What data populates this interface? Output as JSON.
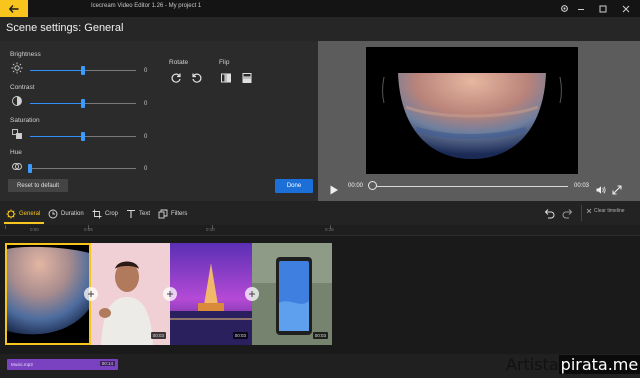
{
  "window": {
    "title": "Icecream Video Editor 1.26 - My project 1",
    "accent": "#f7c51e"
  },
  "header": {
    "title": "Scene settings: General"
  },
  "settings": {
    "adjustments": [
      {
        "label": "Brightness",
        "value": "0",
        "level": 0.5,
        "icon": "sun-icon"
      },
      {
        "label": "Contrast",
        "value": "0",
        "level": 0.5,
        "icon": "contrast-icon"
      },
      {
        "label": "Saturation",
        "value": "0",
        "level": 0.5,
        "icon": "saturation-icon"
      },
      {
        "label": "Hue",
        "value": "0",
        "level": 0.0,
        "icon": "hue-icon"
      }
    ],
    "rotate_label": "Rotate",
    "flip_label": "Flip",
    "reset_label": "Reset to default",
    "done_label": "Done"
  },
  "player": {
    "current_time": "00:00",
    "end_time": "00:03",
    "progress": 0.0
  },
  "tabs": [
    {
      "label": "General",
      "icon": "gear-icon",
      "active": true
    },
    {
      "label": "Duration",
      "icon": "clock-icon",
      "active": false
    },
    {
      "label": "Crop",
      "icon": "crop-icon",
      "active": false
    },
    {
      "label": "Text",
      "icon": "text-icon",
      "active": false
    },
    {
      "label": "Filters",
      "icon": "filters-icon",
      "active": false
    }
  ],
  "toolbar": {
    "clear_label": "Clear timeline"
  },
  "ruler": {
    "ticks": [
      "0:00",
      "0:05",
      "0:10",
      "0:15"
    ]
  },
  "clips": [
    {
      "name": "planet",
      "duration": "",
      "selected": true
    },
    {
      "name": "man",
      "duration": "00:03",
      "selected": false
    },
    {
      "name": "pagoda",
      "duration": "00:03",
      "selected": false
    },
    {
      "name": "phone",
      "duration": "00:03",
      "selected": false
    }
  ],
  "audio": {
    "label": "Music.mp3",
    "duration": "00:14"
  },
  "watermark": {
    "part1": "Artista",
    "part2": "pirata.me"
  }
}
